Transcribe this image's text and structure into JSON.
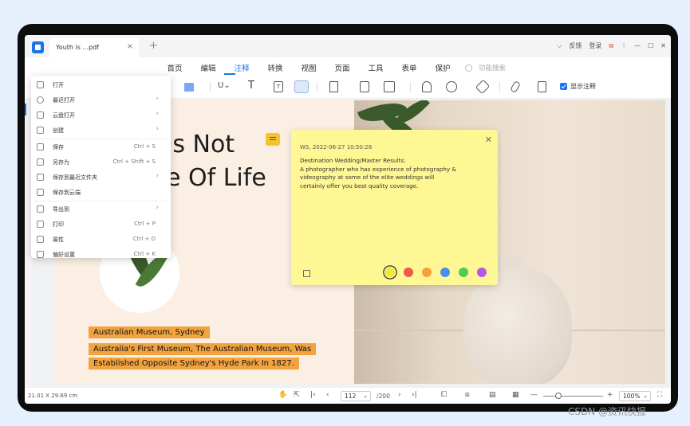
{
  "tab": {
    "title": "Youth is ...pdf",
    "close": "×",
    "add": "+"
  },
  "titlebar": {
    "chevron": "⌵",
    "feedback": "反馈",
    "login": "登录",
    "gift": "⧉",
    "more": "⋮",
    "minimize": "—",
    "maximize": "☐",
    "close": "✕"
  },
  "menu_tabs": [
    "首页",
    "编辑",
    "注释",
    "转换",
    "视图",
    "页面",
    "工具",
    "表单",
    "保护"
  ],
  "active_menu_tab": "注释",
  "func_search": "功能搜索",
  "toolbar": {
    "show_annotations": "显示注释"
  },
  "document": {
    "headline_line1": "ls Not",
    "headline_line2": "e Of Life",
    "highlight1": "Australian Museum, Sydney",
    "highlight2": "Australia's First Museum, The Australian Museum, Was",
    "highlight3": "Established Opposite Sydney's Hyde Park In 1827."
  },
  "sticky_note": {
    "header": "WS, 2022-06-27 10:50:28",
    "body": "Destination Wedding/Master Results:\nA photographer who has experience of photography & videography at some of the elite weddings will certainly offer you best quality coverage.",
    "close": "✕",
    "colors": [
      "#f5e73a",
      "#f0574a",
      "#f5a13a",
      "#4c8ff0",
      "#4dcf4a",
      "#b25ae6"
    ],
    "selected_color": "#f5e73a"
  },
  "dropdown": [
    {
      "label": "打开",
      "icon": "open-file-icon",
      "key": "",
      "arrow": ""
    },
    {
      "label": "最近打开",
      "icon": "clock-icon",
      "key": "",
      "arrow": "›"
    },
    {
      "label": "云盘打开",
      "icon": "cloud-icon",
      "key": "",
      "arrow": "›"
    },
    {
      "label": "创建",
      "icon": "create-icon",
      "key": "",
      "arrow": "›"
    },
    {
      "label": "保存",
      "icon": "save-icon",
      "key": "Ctrl + S",
      "arrow": ""
    },
    {
      "label": "另存为",
      "icon": "save-as-icon",
      "key": "Ctrl + Shift + S",
      "arrow": ""
    },
    {
      "label": "保存到最近文件夹",
      "icon": "folder-icon",
      "key": "",
      "arrow": "›"
    },
    {
      "label": "保存到云端",
      "icon": "cloud-upload-icon",
      "key": "",
      "arrow": ""
    },
    {
      "label": "导出到",
      "icon": "export-icon",
      "key": "",
      "arrow": "›"
    },
    {
      "label": "打印",
      "icon": "print-icon",
      "key": "Ctrl + P",
      "arrow": ""
    },
    {
      "label": "属性",
      "icon": "properties-icon",
      "key": "Ctrl + D",
      "arrow": ""
    },
    {
      "label": "偏好设置",
      "icon": "settings-icon",
      "key": "Ctrl + K",
      "arrow": ""
    }
  ],
  "statusbar": {
    "dimensions": "21.01 X 29.69 cm",
    "page_current": "112",
    "page_total": "/200",
    "zoom": "100%",
    "zoom_minus": "—",
    "zoom_plus": "+"
  },
  "watermark": "CSDN @资讯快报"
}
